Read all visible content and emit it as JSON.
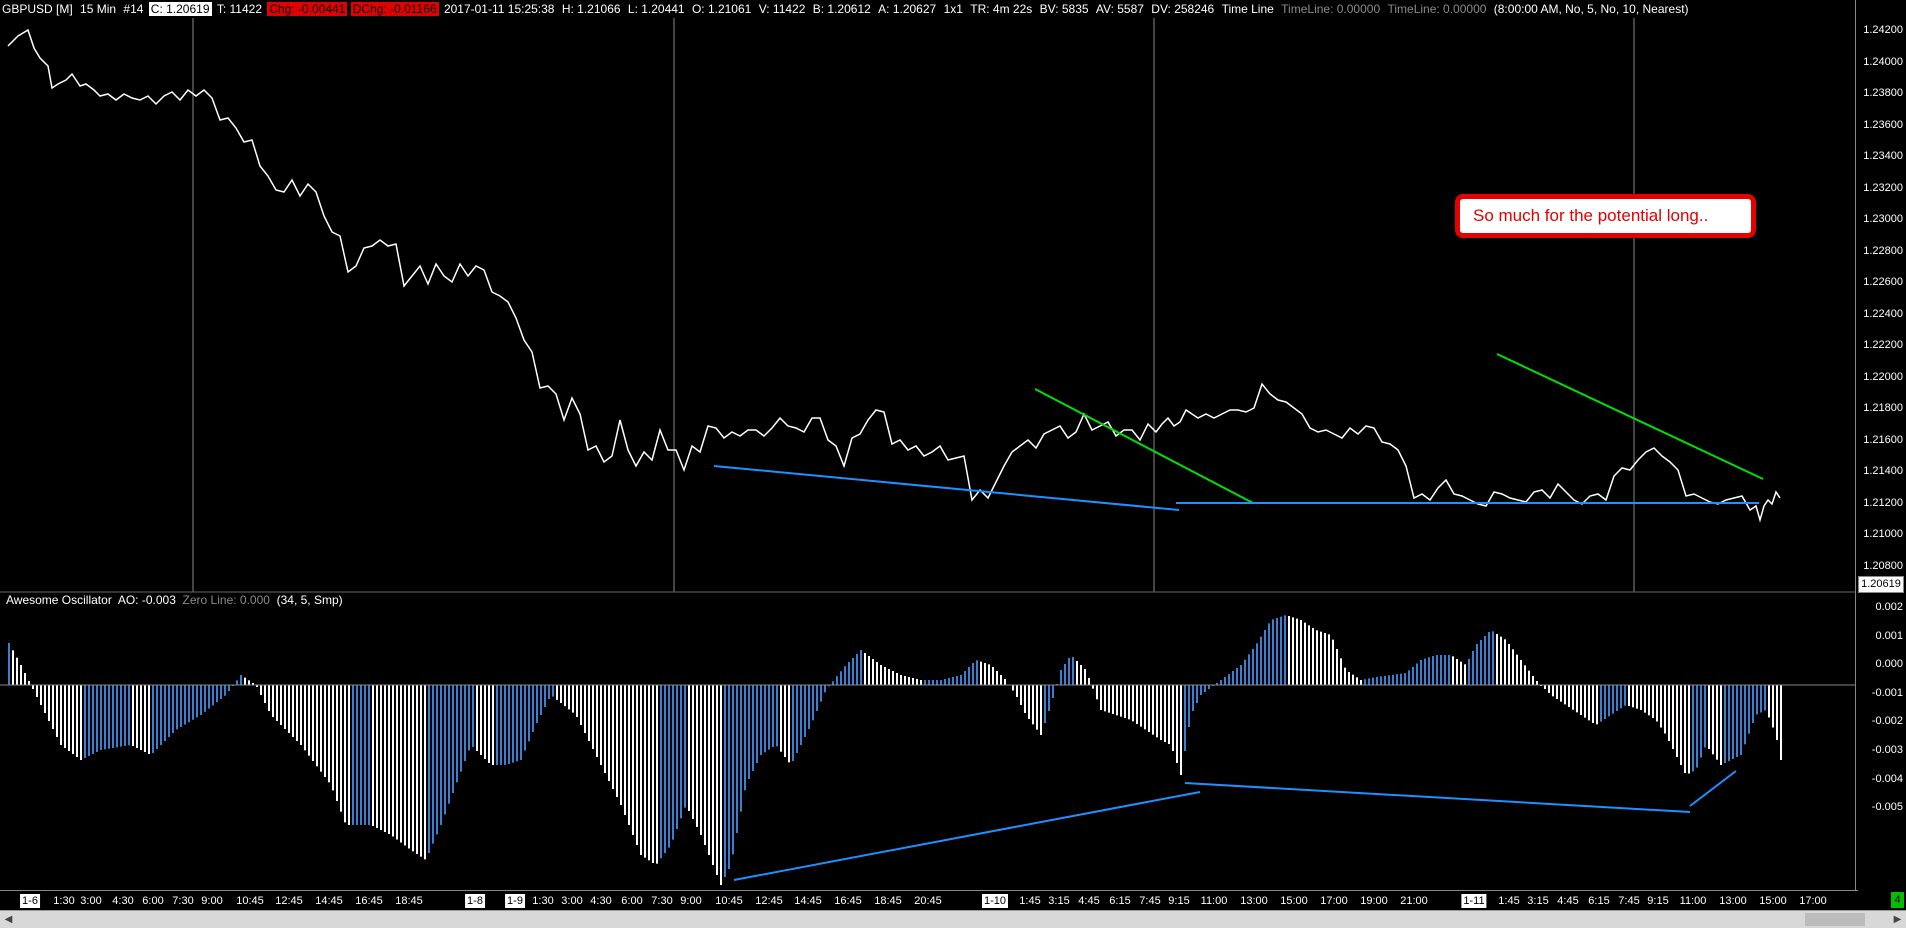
{
  "header": {
    "symbol": "GBPUSD [M]",
    "interval": "15 Min",
    "bars": "#14",
    "close": "C: 1.20619",
    "ticks": "T: 11422",
    "chg": "Chg: -0.00441",
    "dchg": "DChg: -0.01166",
    "datetime": "2017-01-11 15:25:38",
    "high": "H: 1.21066",
    "low": "L: 1.20441",
    "open": "O: 1.21061",
    "volume": "V: 11422",
    "bid": "B: 1.20612",
    "ask": "A: 1.20627",
    "ratio": "1x1",
    "tr": "TR: 4m 22s",
    "bv": "BV: 5835",
    "av": "AV: 5587",
    "dv": "DV: 258246",
    "timeline_label": "Time Line",
    "timeline1": "TimeLine: 0.00000",
    "timeline2": "TimeLine: 0.00000",
    "settings": "(8:00:00 AM, No, 5, No, 10, Nearest)"
  },
  "price_axis": [
    "1.24200",
    "1.24000",
    "1.23800",
    "1.23600",
    "1.23400",
    "1.23200",
    "1.23000",
    "1.22800",
    "1.22600",
    "1.22400",
    "1.22200",
    "1.22000",
    "1.21800",
    "1.21600",
    "1.21400",
    "1.21200",
    "1.21000",
    "1.20800"
  ],
  "last_price": "1.20619",
  "oscillator": {
    "name": "Awesome Oscillator",
    "ao": "AO: -0.003",
    "zero_line": "Zero Line: 0.000",
    "params": "(34, 5, Smp)",
    "axis": [
      "0.002",
      "0.001",
      "0.000",
      "-0.001",
      "-0.002",
      "-0.003",
      "-0.004",
      "-0.005"
    ]
  },
  "annotation": "So much for the potential long..",
  "time_axis": [
    {
      "label": "1-6",
      "day": true
    },
    {
      "label": "1:30"
    },
    {
      "label": "3:00"
    },
    {
      "label": "4:30"
    },
    {
      "label": "6:00"
    },
    {
      "label": "7:30"
    },
    {
      "label": "9:00"
    },
    {
      "label": "10:45"
    },
    {
      "label": "12:45"
    },
    {
      "label": "14:45"
    },
    {
      "label": "16:45"
    },
    {
      "label": "18:45"
    },
    {
      "label": "1-8",
      "day": true
    },
    {
      "label": "1-9",
      "day": true
    },
    {
      "label": "1:30"
    },
    {
      "label": "3:00"
    },
    {
      "label": "4:30"
    },
    {
      "label": "6:00"
    },
    {
      "label": "7:30"
    },
    {
      "label": "9:00"
    },
    {
      "label": "10:45"
    },
    {
      "label": "12:45"
    },
    {
      "label": "14:45"
    },
    {
      "label": "16:45"
    },
    {
      "label": "18:45"
    },
    {
      "label": "20:45"
    },
    {
      "label": "1-10",
      "day": true
    },
    {
      "label": "1:45"
    },
    {
      "label": "3:15"
    },
    {
      "label": "4:45"
    },
    {
      "label": "6:15"
    },
    {
      "label": "7:45"
    },
    {
      "label": "9:15"
    },
    {
      "label": "11:00"
    },
    {
      "label": "13:00"
    },
    {
      "label": "15:00"
    },
    {
      "label": "17:00"
    },
    {
      "label": "19:00"
    },
    {
      "label": "21:00"
    },
    {
      "label": "1-11",
      "day": true
    },
    {
      "label": "1:45"
    },
    {
      "label": "3:15"
    },
    {
      "label": "4:45"
    },
    {
      "label": "6:15"
    },
    {
      "label": "7:45"
    },
    {
      "label": "9:15"
    },
    {
      "label": "11:00"
    },
    {
      "label": "13:00"
    },
    {
      "label": "15:00"
    },
    {
      "label": "17:00"
    }
  ],
  "corner_badge": "4",
  "colors": {
    "price_line": "#ffffff",
    "ao_up": "#3a7fd0",
    "ao_down": "#ffffff",
    "trend_green": "#00e000",
    "trend_blue": "#1e90ff",
    "session_line": "#888888"
  }
}
